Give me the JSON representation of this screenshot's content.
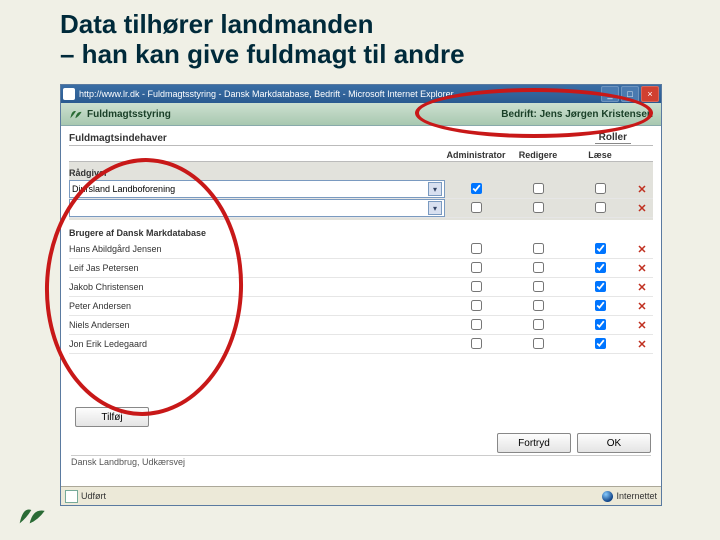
{
  "slide": {
    "title_line1": "Data tilhører landmanden",
    "title_line2": "– han kan give fuldmagt til andre"
  },
  "browser": {
    "title": "http://www.lr.dk - Fuldmagtsstyring - Dansk Markdatabase, Bedrift - Microsoft Internet Explorer",
    "status_left": "Udført",
    "status_zone": "Internettet"
  },
  "app": {
    "header_left": "Fuldmagtsstyring",
    "header_right_label": "Bedrift:",
    "header_right_value": "Jens Jørgen Kristensen",
    "section_givers": "Fuldmagtsindehaver",
    "roles_title": "Roller",
    "col_admin": "Administrator",
    "col_edit": "Redigere",
    "col_read": "Læse",
    "advisor_label": "Rådgiver",
    "advisor_rows": [
      {
        "name": "Djursland Landboforening",
        "admin": true,
        "edit": false,
        "read": false
      },
      {
        "name": "",
        "admin": false,
        "edit": false,
        "read": false
      }
    ],
    "users_label": "Brugere af Dansk Markdatabase",
    "user_rows": [
      {
        "name": "Hans Abildgård Jensen",
        "admin": false,
        "edit": false,
        "read": true
      },
      {
        "name": "Leif Jas Petersen",
        "admin": false,
        "edit": false,
        "read": true
      },
      {
        "name": "Jakob Christensen",
        "admin": false,
        "edit": false,
        "read": true
      },
      {
        "name": "Peter Andersen",
        "admin": false,
        "edit": false,
        "read": true
      },
      {
        "name": "Niels Andersen",
        "admin": false,
        "edit": false,
        "read": true
      },
      {
        "name": "Jon Erik Ledegaard",
        "admin": false,
        "edit": false,
        "read": true
      }
    ],
    "btn_add": "Tilføj",
    "btn_cancel": "Fortryd",
    "btn_ok": "OK",
    "breadcrumb": "Dansk Landbrug, Udkærsvej"
  }
}
